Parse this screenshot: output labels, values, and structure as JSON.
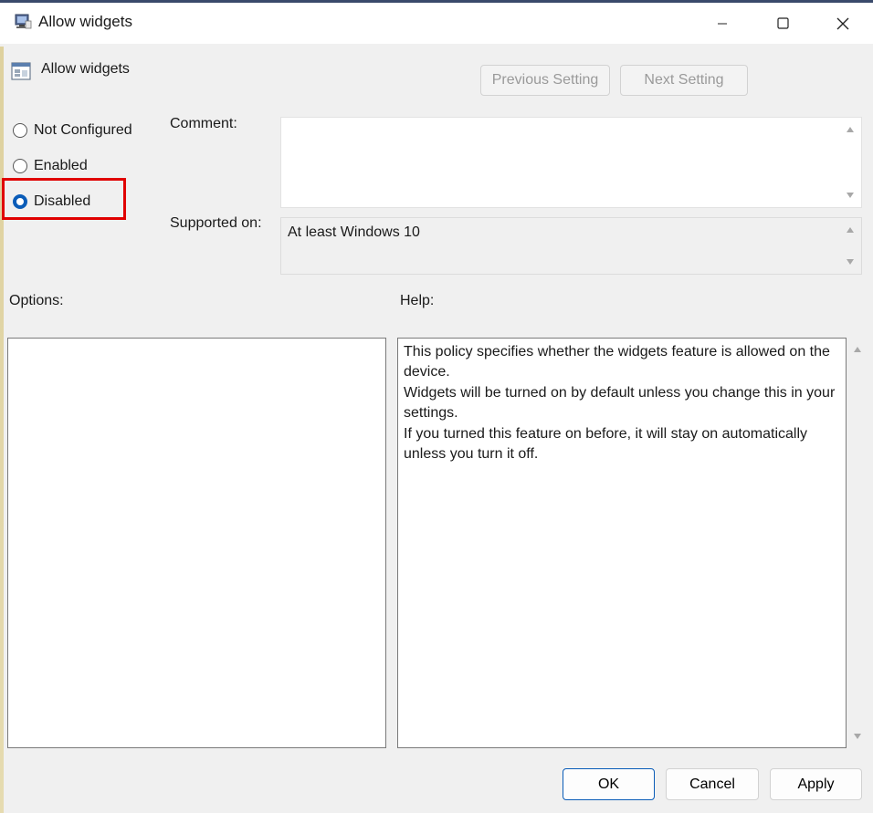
{
  "window": {
    "title": "Allow widgets",
    "icons": [
      "policy-editor-icon",
      "minimize-icon",
      "maximize-icon",
      "close-icon"
    ]
  },
  "header": {
    "policy_name": "Allow widgets",
    "previous_label": "Previous Setting",
    "next_label": "Next Setting"
  },
  "state": {
    "options": [
      {
        "label": "Not Configured",
        "checked": false
      },
      {
        "label": "Enabled",
        "checked": false
      },
      {
        "label": "Disabled",
        "checked": true
      }
    ]
  },
  "fields": {
    "comment_label": "Comment:",
    "comment_value": "",
    "supported_label": "Supported on:",
    "supported_value": "At least Windows 10"
  },
  "options_panel": {
    "label": "Options:"
  },
  "help_panel": {
    "label": "Help:",
    "lines": [
      "This policy specifies whether the widgets feature is allowed on the device.",
      "Widgets will be turned on by default unless you change this in your settings.",
      "If you turned this feature on before, it will stay on automatically unless you turn it off."
    ]
  },
  "footer": {
    "ok_label": "OK",
    "cancel_label": "Cancel",
    "apply_label": "Apply"
  },
  "colors": {
    "accent": "#0a5cb8",
    "highlight": "#e00000"
  }
}
